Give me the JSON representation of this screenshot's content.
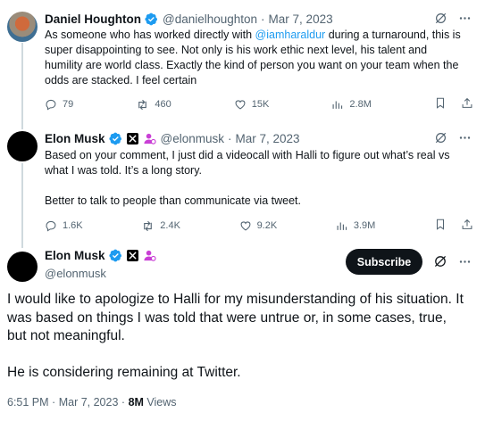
{
  "tweets": [
    {
      "name": "Daniel Houghton",
      "handle": "@danielhoughton",
      "date": "Mar 7, 2023",
      "text_before_mention": "As someone who has worked directly with ",
      "mention": "@iamharaldur",
      "text_after_mention": " during a turnaround, this is super disappointing to see. Not only is his work ethic next level, his talent and humility are world class. Exactly the kind of person you want on your team when the odds are stacked. I feel certain",
      "replies": "79",
      "reposts": "460",
      "likes": "15K",
      "views": "2.8M"
    },
    {
      "name": "Elon Musk",
      "handle": "@elonmusk",
      "date": "Mar 7, 2023",
      "paragraphs": [
        "Based on your comment, I just did a videocall with Halli to figure out what’s real vs what I was told. It’s a long story.",
        "Better to talk to people than communicate via tweet."
      ],
      "replies": "1.6K",
      "reposts": "2.4K",
      "likes": "9.2K",
      "views": "3.9M"
    }
  ],
  "main_tweet": {
    "name": "Elon Musk",
    "handle": "@elonmusk",
    "subscribe_label": "Subscribe",
    "paragraphs": [
      "I would like to apologize to Halli for my misunderstanding of his situation. It was based on things I was told that were untrue or, in some cases, true, but not meaningful.",
      "He is considering remaining at Twitter."
    ],
    "time": "6:51 PM",
    "date": "Mar 7, 2023",
    "views_count": "8M",
    "views_label": "Views"
  },
  "separator": "·",
  "colors": {
    "text": "#0f1419",
    "secondary": "#536471",
    "link": "#1d9bf0",
    "verified": "#1d9bf0",
    "thread_line": "#cfd9de",
    "affiliate_badge": "#c93fd5"
  },
  "icons": [
    "verified-icon",
    "x-affiliate-icon",
    "person-badge-icon",
    "grok-icon",
    "more-icon",
    "reply-icon",
    "repost-icon",
    "like-icon",
    "views-icon",
    "bookmark-icon",
    "share-icon"
  ]
}
